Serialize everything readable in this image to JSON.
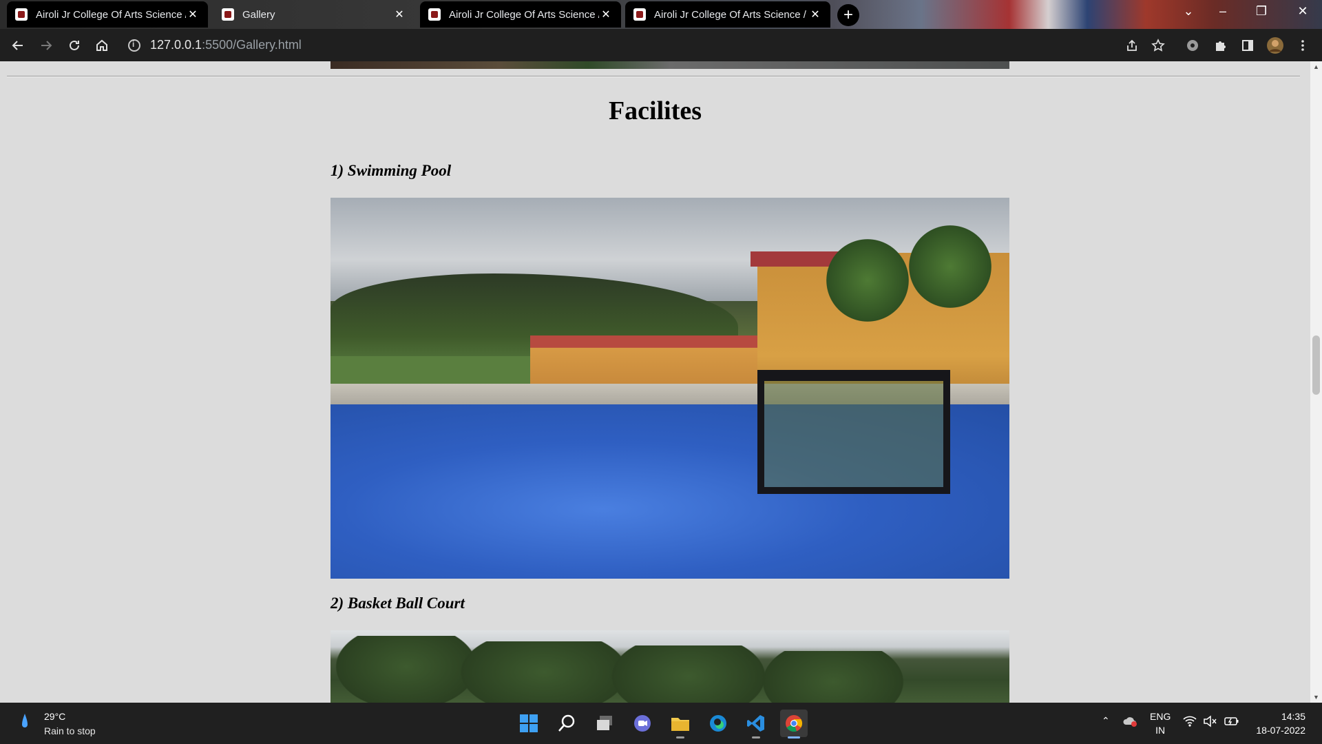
{
  "browser": {
    "tabs": [
      {
        "title": "Airoli Jr College Of Arts Science /",
        "active": true
      },
      {
        "title": "Gallery",
        "active": false
      },
      {
        "title": "Airoli Jr College Of Arts Science /",
        "active": true
      },
      {
        "title": "Airoli Jr College Of Arts Science /",
        "active": true
      }
    ],
    "new_tab_label": "+",
    "url_host": "127.0.0.1",
    "url_path": ":5500/Gallery.html"
  },
  "page": {
    "heading": "Facilites",
    "items": [
      {
        "label": "1) Swimming Pool"
      },
      {
        "label": "2) Basket Ball Court"
      }
    ]
  },
  "taskbar": {
    "weather": {
      "temp": "29°C",
      "condition": "Rain to stop"
    },
    "language": {
      "line1": "ENG",
      "line2": "IN"
    },
    "clock": {
      "time": "14:35",
      "date": "18-07-2022"
    },
    "apps": [
      "start-icon",
      "search-icon",
      "task-view-icon",
      "teams-chat-icon",
      "file-explorer-icon",
      "edge-icon",
      "vscode-icon",
      "chrome-icon"
    ]
  }
}
